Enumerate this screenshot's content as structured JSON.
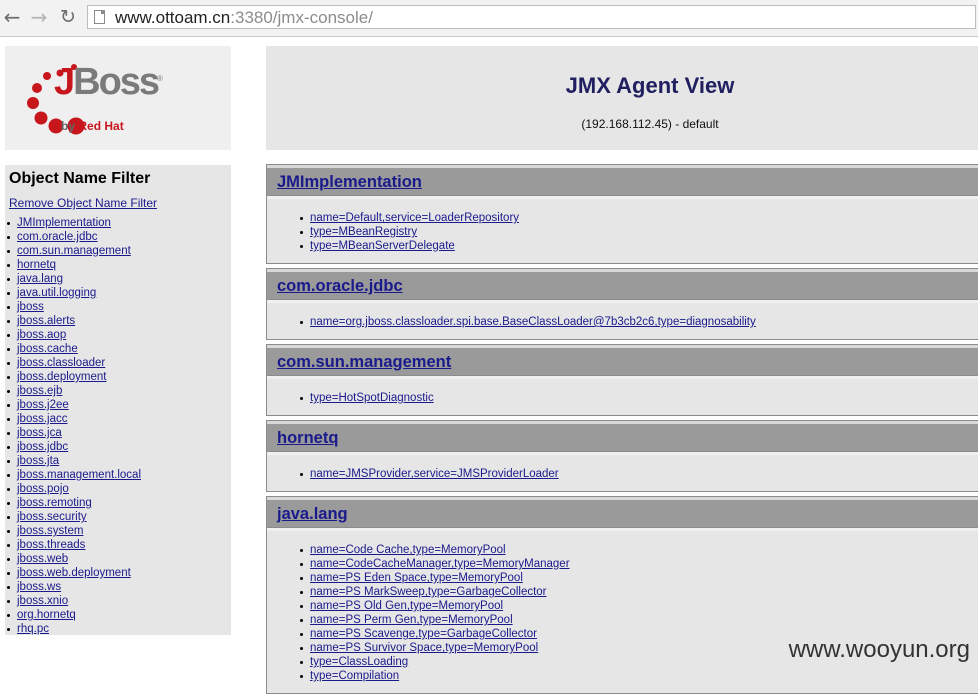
{
  "browser": {
    "url_host": "www.ottoam.cn",
    "url_rest": ":3380/jmx-console/"
  },
  "logo": {
    "brand": "JBoss",
    "byline_prefix": "by",
    "byline_company": "Red Hat",
    "registered": "®"
  },
  "header": {
    "title": "JMX Agent View",
    "subtitle": "(192.168.112.45) - default"
  },
  "filter": {
    "heading": "Object Name Filter",
    "remove_label": "Remove Object Name Filter",
    "items": [
      "JMImplementation",
      "com.oracle.jdbc",
      "com.sun.management",
      "hornetq",
      "java.lang",
      "java.util.logging",
      "jboss",
      "jboss.alerts",
      "jboss.aop",
      "jboss.cache",
      "jboss.classloader",
      "jboss.deployment",
      "jboss.ejb",
      "jboss.j2ee",
      "jboss.jacc",
      "jboss.jca",
      "jboss.jdbc",
      "jboss.jta",
      "jboss.management.local",
      "jboss.pojo",
      "jboss.remoting",
      "jboss.security",
      "jboss.system",
      "jboss.threads",
      "jboss.web",
      "jboss.web.deployment",
      "jboss.ws",
      "jboss.xnio",
      "org.hornetq",
      "rhq.pc"
    ]
  },
  "domains": [
    {
      "name": "JMImplementation",
      "mbeans": [
        "name=Default,service=LoaderRepository",
        "type=MBeanRegistry",
        "type=MBeanServerDelegate"
      ]
    },
    {
      "name": "com.oracle.jdbc",
      "mbeans": [
        "name=org.jboss.classloader.spi.base.BaseClassLoader@7b3cb2c6,type=diagnosability"
      ]
    },
    {
      "name": "com.sun.management",
      "mbeans": [
        "type=HotSpotDiagnostic"
      ]
    },
    {
      "name": "hornetq",
      "mbeans": [
        "name=JMSProvider,service=JMSProviderLoader"
      ]
    },
    {
      "name": "java.lang",
      "mbeans": [
        "name=Code Cache,type=MemoryPool",
        "name=CodeCacheManager,type=MemoryManager",
        "name=PS Eden Space,type=MemoryPool",
        "name=PS MarkSweep,type=GarbageCollector",
        "name=PS Old Gen,type=MemoryPool",
        "name=PS Perm Gen,type=MemoryPool",
        "name=PS Scavenge,type=GarbageCollector",
        "name=PS Survivor Space,type=MemoryPool",
        "type=ClassLoading",
        "type=Compilation"
      ]
    }
  ],
  "watermark": "www.wooyun.org",
  "colors": {
    "link": "#1a1a8c",
    "title": "#202060",
    "header_bg": "#e6e6e6",
    "domain_head_bg": "#9a9a9a",
    "brand_red": "#c8161d"
  }
}
